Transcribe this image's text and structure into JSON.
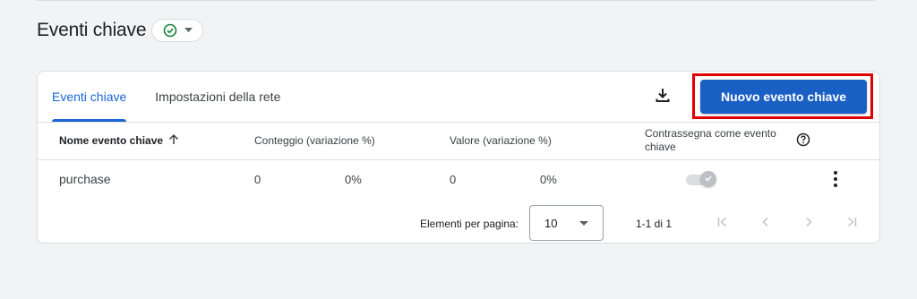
{
  "header": {
    "title": "Eventi chiave",
    "status_icon": "check-circle-icon",
    "status_color": "#188038"
  },
  "tabs": [
    {
      "label": "Eventi chiave",
      "active": true
    },
    {
      "label": "Impostazioni della rete",
      "active": false
    }
  ],
  "toolbar": {
    "download_icon": "download-icon",
    "new_button_label": "Nuovo evento chiave",
    "accent_color": "#1a5fc4",
    "highlight_color": "#e00000"
  },
  "table": {
    "columns": {
      "name": "Nome evento chiave",
      "count": "Conteggio (variazione %)",
      "value": "Valore (variazione %)",
      "mark_line1": "Contrassegna come evento",
      "mark_line2": "chiave"
    },
    "sort_icon": "arrow-up-icon",
    "help_icon": "help-circle-icon",
    "rows": [
      {
        "name": "purchase",
        "count": "0",
        "count_change": "0%",
        "value": "0",
        "value_change": "0%",
        "marked": true,
        "toggle_disabled": true
      }
    ]
  },
  "pagination": {
    "label": "Elementi per pagina:",
    "page_size": "10",
    "range": "1-1 di 1",
    "icons": [
      "first-page-icon",
      "previous-page-icon",
      "next-page-icon",
      "last-page-icon"
    ]
  }
}
